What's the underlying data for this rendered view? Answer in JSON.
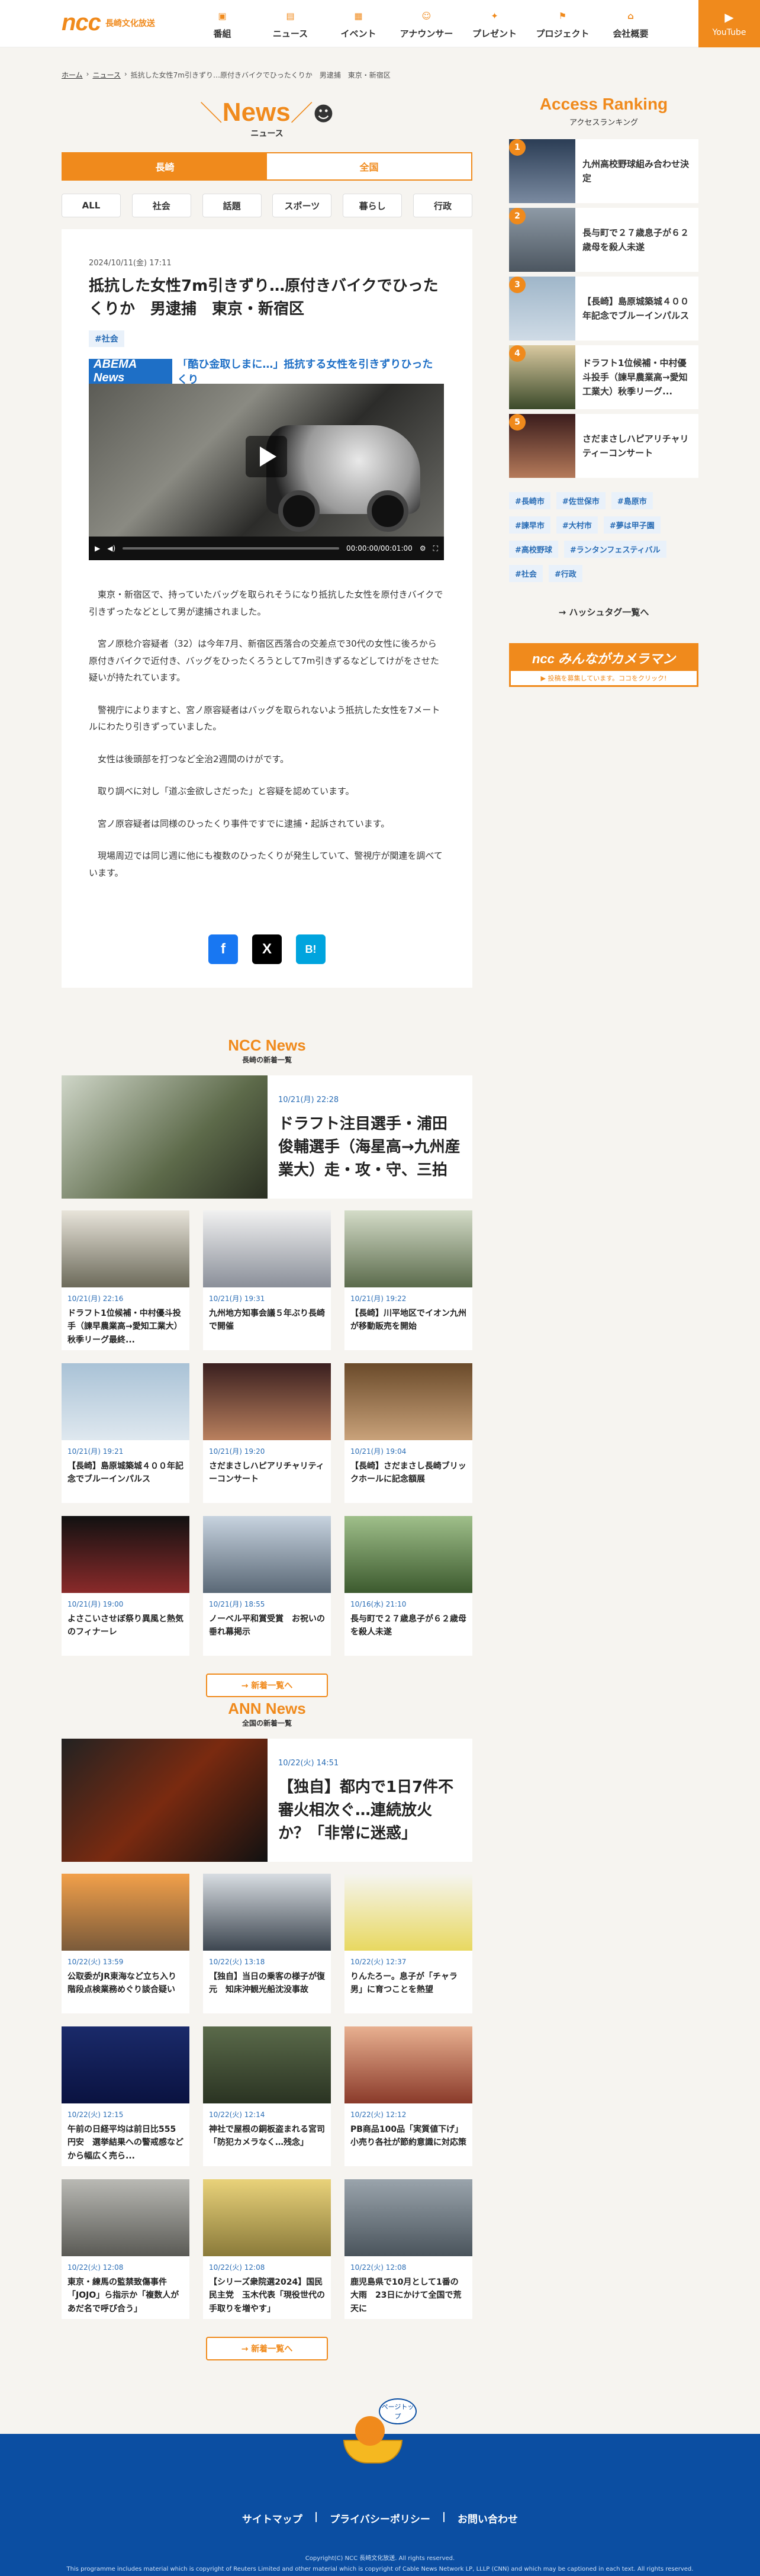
{
  "header": {
    "logo": "ncc",
    "logo_sub": "長崎文化放送",
    "nav": [
      {
        "label": "番組",
        "icon": "tv-icon"
      },
      {
        "label": "ニュース",
        "icon": "news-icon"
      },
      {
        "label": "イベント",
        "icon": "calendar-icon"
      },
      {
        "label": "アナウンサー",
        "icon": "announcer-icon"
      },
      {
        "label": "プレゼント",
        "icon": "gift-icon"
      },
      {
        "label": "プロジェクト",
        "icon": "flag-icon"
      },
      {
        "label": "会社概要",
        "icon": "company-icon"
      }
    ],
    "youtube": "YouTube"
  },
  "breadcrumb": [
    "ホーム",
    "ニュース",
    "抵抗した女性7m引きずり…原付きバイクでひったくりか　男逮捕　東京・新宿区"
  ],
  "news_head": {
    "title": "News",
    "sub": "ニュース"
  },
  "region_tabs": [
    "長崎",
    "全国"
  ],
  "cat_tabs": [
    "ALL",
    "社会",
    "話題",
    "スポーツ",
    "暮らし",
    "行政"
  ],
  "article": {
    "date": "2024/10/11(金) 17:11",
    "title": "抵抗した女性7m引きずり…原付きバイクでひったくりか　男逮捕　東京・新宿区",
    "tag": "#社会",
    "video": {
      "brand": "ABEMA News",
      "caption": "「酷ひ金取しまに…」抵抗する女性を引きずりひったくり",
      "time": "00:00:00/00:01:00"
    },
    "paragraphs": [
      "　東京・新宿区で、持っていたバッグを取られそうになり抵抗した女性を原付きバイクで引きずったなどとして男が逮捕されました。",
      "　宮ノ原稔介容疑者（32）は今年7月、新宿区西落合の交差点で30代の女性に後ろから原付きバイクで近付き、バッグをひったくろうとして7m引きずるなどしてけがをさせた疑いが持たれています。",
      "　警視庁によりますと、宮ノ原容疑者はバッグを取られないよう抵抗した女性を7メートルにわたり引きずっていました。",
      "　女性は後頭部を打つなど全治2週間のけがです。",
      "　取り調べに対し「道ぶ金欲しさだった」と容疑を認めています。",
      "　宮ノ原容疑者は同様のひったくり事件ですでに逮捕・起訴されています。",
      "　現場周辺では同じ週に他にも複数のひったくりが発生していて、警視庁が関連を調べています。"
    ],
    "share": [
      "f",
      "X",
      "B!"
    ]
  },
  "ranking": {
    "title": "Access Ranking",
    "sub": "アクセスランキング",
    "items": [
      {
        "num": "1",
        "text": "九州高校野球組み合わせ決定"
      },
      {
        "num": "2",
        "text": "長与町で２７歳息子が６２歳母を殺人未遂"
      },
      {
        "num": "3",
        "text": "【長崎】島原城築城４００年記念でブルーインパルス"
      },
      {
        "num": "4",
        "text": "ドラフト1位候補・中村優斗投手（諫早農業高→愛知工業大）秋季リーグ..."
      },
      {
        "num": "5",
        "text": "さだまさしハピアリチャリティーコンサート"
      }
    ]
  },
  "tags": [
    "#長崎市",
    "#佐世保市",
    "#島原市",
    "#諫早市",
    "#大村市",
    "#夢は甲子園",
    "#高校野球",
    "#ランタンフェスティバル",
    "#社会",
    "#行政"
  ],
  "tag_more": "ハッシュタグ一覧へ",
  "banner": {
    "top": "ncc みんながカメラマン",
    "bottom": "▶ 投稿を募集しています。ココをクリック!"
  },
  "ncc_news": {
    "title": "NCC News",
    "sub": "長崎の新着一覧",
    "feature": {
      "date": "10/21(月) 22:28",
      "title": "ドラフト注目選手・浦田俊輔選手（海星高→九州産業大）走・攻・守、三拍子そろった"
    },
    "cards": [
      {
        "date": "10/21(月) 22:16",
        "title": "ドラフト1位候補・中村優斗投手（諫早農業高→愛知工業大）秋季リーグ最終..."
      },
      {
        "date": "10/21(月) 19:31",
        "title": "九州地方知事会議５年ぶり長崎で開催"
      },
      {
        "date": "10/21(月) 19:22",
        "title": "【長崎】川平地区でイオン九州が移動販売を開始"
      },
      {
        "date": "10/21(月) 19:21",
        "title": "【長崎】島原城築城４００年記念でブルーインパルス"
      },
      {
        "date": "10/21(月) 19:20",
        "title": "さだまさしハピアリチャリティーコンサート"
      },
      {
        "date": "10/21(月) 19:04",
        "title": "【長崎】さだまさし長崎ブリックホールに記念額展"
      },
      {
        "date": "10/21(月) 19:00",
        "title": "よさこいさせぼ祭り異風と熱気のフィナーレ"
      },
      {
        "date": "10/21(月) 18:55",
        "title": "ノーベル平和賞受賞　お祝いの垂れ幕掲示"
      },
      {
        "date": "10/16(水) 21:10",
        "title": "長与町で２７歳息子が６２歳母を殺人未遂"
      }
    ],
    "more": "→ 新着一覧へ"
  },
  "ann_news": {
    "title": "ANN News",
    "sub": "全国の新着一覧",
    "feature": {
      "date": "10/22(火) 14:51",
      "title": "【独自】都内で1日7件不審火相次ぐ…連続放火か？「非常に迷惑」"
    },
    "cards": [
      {
        "date": "10/22(火) 13:59",
        "title": "公取委がJR東海など立ち入り　階段点検業務めぐり談合疑い"
      },
      {
        "date": "10/22(火) 13:18",
        "title": "【独自】当日の乗客の様子が復元　知床沖観光船沈没事故"
      },
      {
        "date": "10/22(火) 12:37",
        "title": "りんたろー。息子が「チャラ男」に育つことを熱望"
      },
      {
        "date": "10/22(火) 12:15",
        "title": "午前の日経平均は前日比555円安　選挙結果への警戒感などから幅広く売ら..."
      },
      {
        "date": "10/22(火) 12:14",
        "title": "神社で屋根の銅板盗まれる宮司「防犯カメラなく…残念」"
      },
      {
        "date": "10/22(火) 12:12",
        "title": "PB商品100品「実質値下げ」小売り各社が節約意識に対応策"
      },
      {
        "date": "10/22(火) 12:08",
        "title": "東京・練馬の監禁致傷事件「JOJO」ら指示か「複数人があだ名で呼び合う」"
      },
      {
        "date": "10/22(火) 12:08",
        "title": "【シリーズ衆院選2024】国民民主党　玉木代表「現役世代の手取りを増やす」"
      },
      {
        "date": "10/22(火) 12:08",
        "title": "鹿児島県で10月として1番の大雨　23日にかけて全国で荒天に"
      }
    ],
    "more": "→ 新着一覧へ"
  },
  "footer": {
    "page_top": "ページトップ",
    "links": [
      "サイトマップ",
      "プライバシーポリシー",
      "お問い合わせ"
    ],
    "sep": "|",
    "copyright": "Copyright(C) NCC 長崎文化放送. All rights reserved.",
    "note": "This programme includes material which is copyright of Reuters Limited and other material which is copyright of Cable News Network LP, LLLP (CNN) and which may be captioned in each text. All rights reserved."
  },
  "colors": {
    "accent": "#f08a1c",
    "link": "#2a6db5",
    "footer": "#0b4ea2"
  }
}
